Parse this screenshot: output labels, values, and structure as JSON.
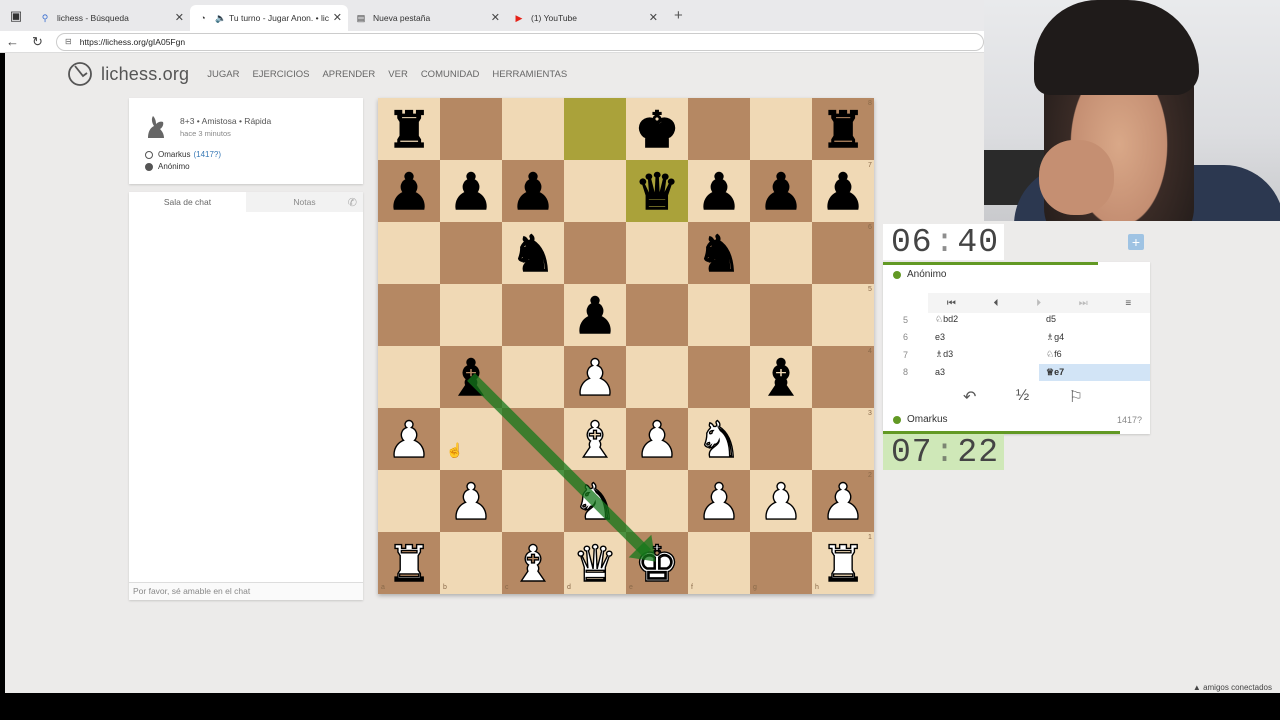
{
  "browser": {
    "tabs": [
      {
        "title": "lichess - Búsqueda",
        "icon": "search-icon",
        "active": false
      },
      {
        "title": "Tu turno - Jugar Anon. • lichess",
        "icon": "lichess-icon",
        "active": true
      },
      {
        "title": "Nueva pestaña",
        "icon": "page-icon",
        "active": false
      },
      {
        "title": "(1) YouTube",
        "icon": "youtube-icon",
        "active": false
      }
    ],
    "url": "https://lichess.org/gIA05Fgn"
  },
  "site": {
    "logo": "lichess.org",
    "nav": [
      "JUGAR",
      "EJERCICIOS",
      "APRENDER",
      "VER",
      "COMUNIDAD",
      "HERRAMIENTAS"
    ]
  },
  "game_info": {
    "setup": "8+3 • Amistosa • Rápida",
    "when": "hace 3 minutos",
    "white_player": "Omarkus",
    "white_rating": "(1417?)",
    "black_player": "Anónimo"
  },
  "chat": {
    "tab_chat": "Sala de chat",
    "tab_notes": "Notas",
    "input_placeholder": "Por favor, sé amable en el chat"
  },
  "board": {
    "highlight_squares": [
      "d8",
      "e7"
    ],
    "arrow": {
      "from": "b4",
      "to": "e1",
      "color": "#15781b"
    },
    "pieces": [
      {
        "sq": "a8",
        "p": "r"
      },
      {
        "sq": "e8",
        "p": "k"
      },
      {
        "sq": "h8",
        "p": "r"
      },
      {
        "sq": "a7",
        "p": "p"
      },
      {
        "sq": "b7",
        "p": "p"
      },
      {
        "sq": "c7",
        "p": "p"
      },
      {
        "sq": "e7",
        "p": "q"
      },
      {
        "sq": "f7",
        "p": "p"
      },
      {
        "sq": "g7",
        "p": "p"
      },
      {
        "sq": "h7",
        "p": "p"
      },
      {
        "sq": "c6",
        "p": "n"
      },
      {
        "sq": "f6",
        "p": "n"
      },
      {
        "sq": "d5",
        "p": "p"
      },
      {
        "sq": "b4",
        "p": "b"
      },
      {
        "sq": "d4",
        "p": "P"
      },
      {
        "sq": "g4",
        "p": "b"
      },
      {
        "sq": "a3",
        "p": "P"
      },
      {
        "sq": "d3",
        "p": "B"
      },
      {
        "sq": "e3",
        "p": "P"
      },
      {
        "sq": "f3",
        "p": "N"
      },
      {
        "sq": "b2",
        "p": "P"
      },
      {
        "sq": "d2",
        "p": "N"
      },
      {
        "sq": "f2",
        "p": "P"
      },
      {
        "sq": "g2",
        "p": "P"
      },
      {
        "sq": "h2",
        "p": "P"
      },
      {
        "sq": "a1",
        "p": "R"
      },
      {
        "sq": "c1",
        "p": "B"
      },
      {
        "sq": "d1",
        "p": "Q"
      },
      {
        "sq": "e1",
        "p": "K"
      },
      {
        "sq": "h1",
        "p": "R"
      }
    ]
  },
  "clocks": {
    "top": {
      "min": "06",
      "sec": "40"
    },
    "bottom": {
      "min": "07",
      "sec": "22"
    }
  },
  "panel": {
    "top_player": "Anónimo",
    "bottom_player": "Omarkus",
    "bottom_rating": "1417?",
    "moves": [
      {
        "num": "5",
        "white": "♘bd2",
        "black": "d5"
      },
      {
        "num": "6",
        "white": "e3",
        "black": "♗g4"
      },
      {
        "num": "7",
        "white": "♗d3",
        "black": "♘f6"
      },
      {
        "num": "8",
        "white": "a3",
        "black": "♕e7"
      }
    ],
    "selected_move": "♕e7",
    "draw_label": "½"
  },
  "footer": {
    "friends": "▲ amigos conectados"
  },
  "colors": {
    "accent": "#629924",
    "link": "#3778b5",
    "board_light": "#f0d9b5",
    "board_dark": "#b58863"
  }
}
